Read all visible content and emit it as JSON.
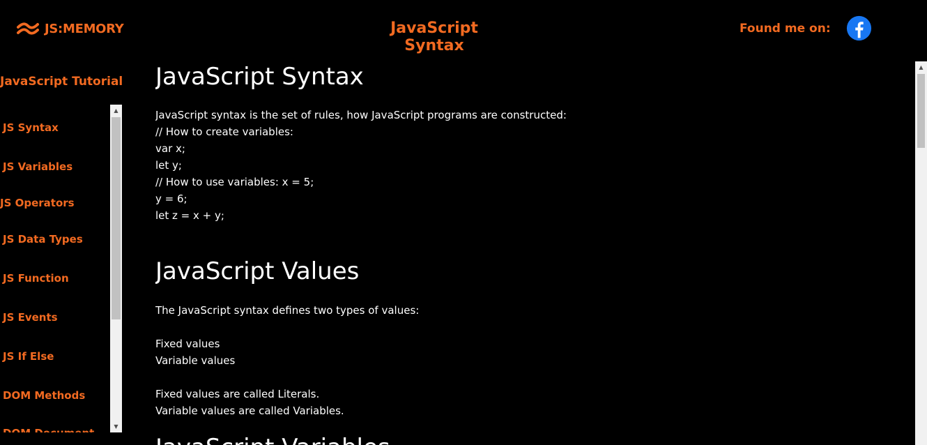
{
  "header": {
    "brand": "JS:MEMORY",
    "title": "JavaScript Syntax",
    "found_me": "Found me on:",
    "social_icon": "facebook-icon"
  },
  "sidebar": {
    "title": "JavaScript Tutorial",
    "items": [
      {
        "label": "JS Syntax"
      },
      {
        "label": "JS Variables"
      },
      {
        "label": "JS Operators"
      },
      {
        "label": "JS Data Types"
      },
      {
        "label": "JS Function"
      },
      {
        "label": "JS Events"
      },
      {
        "label": "JS If Else"
      },
      {
        "label": "DOM Methods"
      },
      {
        "label": "DOM Document"
      }
    ]
  },
  "main": {
    "section1": {
      "heading": "JavaScript Syntax",
      "lines": [
        "JavaScript syntax is the set of rules, how JavaScript programs are constructed:",
        "// How to create variables:",
        "var x;",
        "let y;",
        "// How to use variables: x = 5;",
        "y = 6;",
        "let z = x + y;"
      ]
    },
    "section2": {
      "heading": "JavaScript Values",
      "intro": "The JavaScript syntax defines two types of values:",
      "types": [
        "Fixed values",
        "Variable values"
      ],
      "notes": [
        "Fixed values are called Literals.",
        "Variable values are called Variables."
      ]
    },
    "section3": {
      "heading": "JavaScript Variables"
    }
  },
  "colors": {
    "accent": "#f26a21",
    "background": "#000000",
    "text": "#ffffff",
    "facebook": "#1877f2"
  }
}
